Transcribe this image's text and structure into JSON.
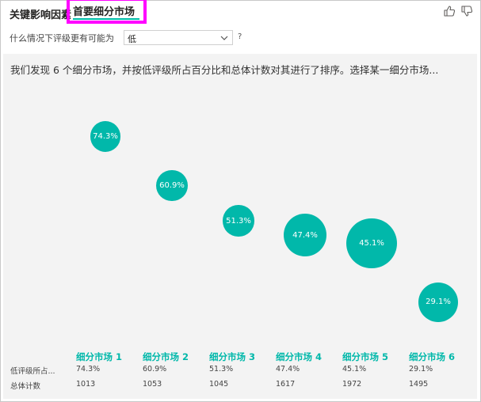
{
  "tabs": {
    "key_influencers": "关键影响因素",
    "top_segments": "首要细分市场"
  },
  "colors": {
    "accent": "#01b8aa",
    "highlight_box": "#ff00ff",
    "panel_bg": "#f3f3f3"
  },
  "icons": {
    "thumbs_up": "thumbs-up-icon",
    "thumbs_down": "thumbs-down-icon",
    "dropdown": "chevron-down-icon"
  },
  "filter": {
    "label": "什么情况下评级更有可能为",
    "value": "低",
    "help": "?"
  },
  "summary": "我们发现 6 个细分市场，并按低评级所占百分比和总体计数对其进行了排序。选择某一细分市场...",
  "table": {
    "row_labels": [
      "低评级所占...",
      "总体计数"
    ]
  },
  "segments": [
    {
      "name": "细分市场 1",
      "pct_label": "74.3%",
      "pct": 74.3,
      "count": "1013",
      "count_value": 1013
    },
    {
      "name": "细分市场 2",
      "pct_label": "60.9%",
      "pct": 60.9,
      "count": "1053",
      "count_value": 1053
    },
    {
      "name": "细分市场 3",
      "pct_label": "51.3%",
      "pct": 51.3,
      "count": "1045",
      "count_value": 1045
    },
    {
      "name": "细分市场 4",
      "pct_label": "47.4%",
      "pct": 47.4,
      "count": "1617",
      "count_value": 1617
    },
    {
      "name": "细分市场 5",
      "pct_label": "45.1%",
      "pct": 45.1,
      "count": "1972",
      "count_value": 1972
    },
    {
      "name": "细分市场 6",
      "pct_label": "29.1%",
      "pct": 29.1,
      "count": "1495",
      "count_value": 1495
    }
  ]
}
